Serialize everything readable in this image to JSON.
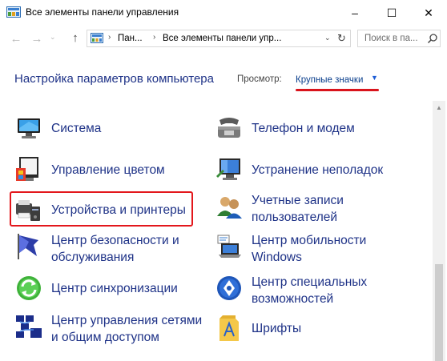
{
  "window": {
    "title": "Все элементы панели управления",
    "controls": {
      "minimize": "–",
      "maximize": "☐",
      "close": "✕"
    }
  },
  "nav": {
    "back": "←",
    "forward": "→",
    "recent": "⌄",
    "up": "↑",
    "address": {
      "crumbs": [
        "Пан...",
        "Все элементы панели упр..."
      ],
      "separator": "›",
      "dropdown": "⌄",
      "refresh": "↻"
    },
    "search": {
      "placeholder": "Поиск в па..."
    }
  },
  "header": {
    "title": "Настройка параметров компьютера",
    "view_label": "Просмотр:",
    "view_value": "Крупные значки",
    "view_caret": "▼"
  },
  "items": [
    {
      "label": "Система",
      "icon": "system-icon"
    },
    {
      "label": "Телефон и модем",
      "icon": "phone-modem-icon"
    },
    {
      "label": "Управление цветом",
      "icon": "color-management-icon"
    },
    {
      "label": "Устранение неполадок",
      "icon": "troubleshooting-icon"
    },
    {
      "label": "Устройства и принтеры",
      "icon": "devices-printers-icon"
    },
    {
      "label": "Учетные записи\nпользователей",
      "icon": "user-accounts-icon"
    },
    {
      "label": "Центр безопасности и\nобслуживания",
      "icon": "security-center-icon"
    },
    {
      "label": "Центр мобильности\nWindows",
      "icon": "mobility-center-icon"
    },
    {
      "label": "Центр синхронизации",
      "icon": "sync-center-icon"
    },
    {
      "label": "Центр специальных\nвозможностей",
      "icon": "accessibility-icon"
    },
    {
      "label": "Центр управления сетями\nи общим доступом",
      "icon": "network-center-icon"
    },
    {
      "label": "Шрифты",
      "icon": "fonts-icon"
    }
  ],
  "colors": {
    "link_text": "#1e3287",
    "highlight": "#e3171c",
    "view_link": "#0a3e8c"
  }
}
